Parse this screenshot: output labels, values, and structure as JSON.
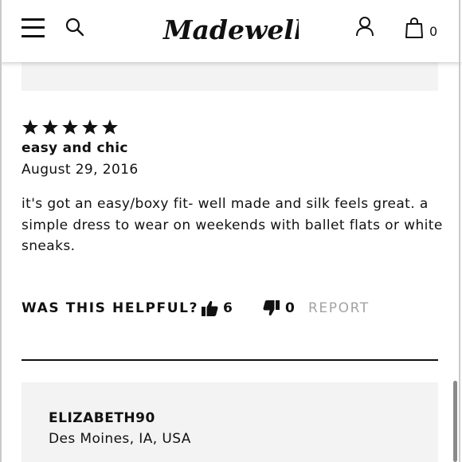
{
  "header": {
    "logo_text": "Madewell",
    "bag_count": "0",
    "icons": [
      "menu-icon",
      "search-icon",
      "account-icon",
      "shopping-bag-icon"
    ]
  },
  "review": {
    "rating": 5,
    "title": "easy and chic",
    "date": "August 29, 2016",
    "body": "it's got an easy/boxy fit- well made and silk feels great. a simple dress to wear on weekends with ballet flats or white sneaks.",
    "helpful": {
      "label": "WAS THIS HELPFUL?",
      "up_count": "6",
      "down_count": "0",
      "report_label": "REPORT"
    }
  },
  "next_review": {
    "reviewer": "ELIZABETH90",
    "location": "Des Moines, IA, USA"
  },
  "colors": {
    "text": "#111111",
    "muted": "#a3a3a3",
    "card_bg": "#f3f3f3"
  }
}
